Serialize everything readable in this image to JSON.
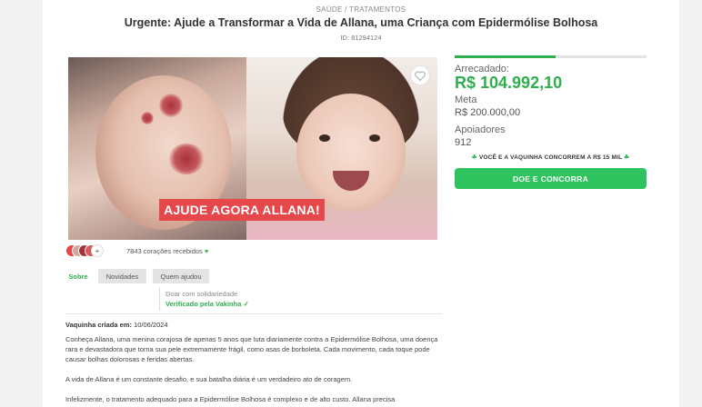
{
  "header": {
    "category": "SAÚDE / TRATAMENTOS",
    "title": "Urgente: Ajude a Transformar a Vida de Allana, uma Criança com Epidermólise Bolhosa",
    "id_label": "ID: 81294124"
  },
  "hero": {
    "banner": "AJUDE AGORA ALLANA!",
    "favorite_icon": "heart-outline-icon"
  },
  "hearts": {
    "text": "7843 corações recebidos",
    "icon": "♥",
    "more_icon": "+"
  },
  "tabs": [
    {
      "label": "Sobre"
    },
    {
      "label": "Novidades"
    },
    {
      "label": "Quem ajudou"
    }
  ],
  "verification": {
    "label": "Doar com solidariedade",
    "status": "Verificado pela Vakinha ✓"
  },
  "created": {
    "label": "Vaquinha criada em:",
    "date": "10/06/2024"
  },
  "description": [
    "Conheça Allana, uma menina corajosa de apenas 5 anos que luta diariamente contra a Epidermólise Bolhosa, uma doença rara e devastadora que torna sua pele extremamente frágil, como asas de borboleta. Cada movimento, cada toque pode causar bolhas dolorosas e feridas abertas.",
    "A vida de Allana é um constante desafio, e sua batalha diária é um verdadeiro ato de coragem.",
    "Infelizmente, o tratamento adequado para a Epidermólise Bolhosa é complexo e de alto custo. Allana precisa"
  ],
  "sidebar": {
    "raised_label": "Arrecadado:",
    "raised_value": "R$ 104.992,10",
    "goal_label": "Meta",
    "goal_value": "R$ 200.000,00",
    "supporters_label": "Apoiadores",
    "supporters_value": "912",
    "progress_fraction": 0.525,
    "promo": "VOCÊ E A VAQUINHA CONCORREM A R$ 15 MIL",
    "promo_icon": "☘",
    "donate_label": "DOE E CONCORRA"
  },
  "colors": {
    "accent": "#2fae4e",
    "button": "#2fc360",
    "banner": "#e5474b"
  }
}
